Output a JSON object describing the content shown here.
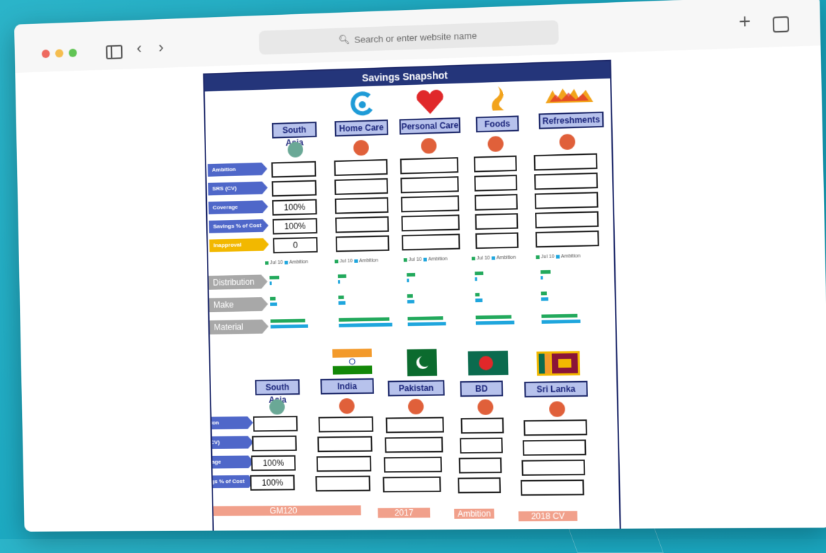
{
  "browser": {
    "search_placeholder": "Search or enter website name"
  },
  "sheet": {
    "title": "Savings Snapshot",
    "top": {
      "headers": [
        "South Asia",
        "Home Care",
        "Personal Care",
        "Foods",
        "Refreshments"
      ],
      "row_labels": [
        "Ambition",
        "SRS (CV)",
        "Coverage",
        "Savings % of Cost",
        "Inapproval"
      ],
      "south_asia_values": [
        "",
        "",
        "100%",
        "100%",
        "0"
      ],
      "legend": [
        "Jul 10",
        "Ambition"
      ],
      "category_labels": [
        "Distribution",
        "Make",
        "Material"
      ]
    },
    "bottom": {
      "headers": [
        "South Asia",
        "India",
        "Pakistan",
        "BD",
        "Sri Lanka"
      ],
      "row_labels": [
        "Ambition",
        "SRS (CV)",
        "Coverage",
        "Savings % of Cost"
      ],
      "south_asia_values": [
        "",
        "",
        "100%",
        "100%"
      ]
    },
    "footer": [
      "GM120",
      "2017",
      "Ambition",
      "2018 CV"
    ]
  },
  "colors": {
    "brand_blue": "#24357a",
    "tag_blue": "#4f67c9",
    "orange_dot": "#e0603a",
    "green_dot": "#6aa896",
    "bar_green": "#22a95c",
    "bar_blue": "#1fa6dd"
  }
}
